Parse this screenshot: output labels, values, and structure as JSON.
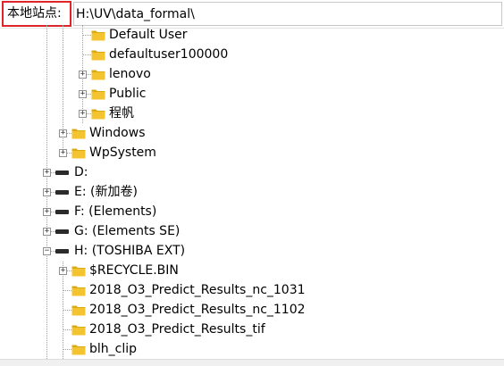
{
  "site_bar": {
    "label": "本地站点:",
    "path": "H:\\UV\\data_formal\\"
  },
  "tree": {
    "items": [
      {
        "label": "Default User",
        "kind": "folder",
        "expander": "none"
      },
      {
        "label": "defaultuser100000",
        "kind": "folder",
        "expander": "none"
      },
      {
        "label": "lenovo",
        "kind": "folder",
        "expander": "collapsed"
      },
      {
        "label": "Public",
        "kind": "folder",
        "expander": "collapsed"
      },
      {
        "label": "程帆",
        "kind": "folder",
        "expander": "collapsed"
      },
      {
        "label": "Windows",
        "kind": "folder",
        "expander": "collapsed"
      },
      {
        "label": "WpSystem",
        "kind": "folder",
        "expander": "collapsed"
      },
      {
        "label": "D:",
        "kind": "drive",
        "expander": "collapsed"
      },
      {
        "label": "E: (新加卷)",
        "kind": "drive",
        "expander": "collapsed"
      },
      {
        "label": "F: (Elements)",
        "kind": "drive",
        "expander": "collapsed"
      },
      {
        "label": "G: (Elements SE)",
        "kind": "drive",
        "expander": "collapsed"
      },
      {
        "label": "H: (TOSHIBA EXT)",
        "kind": "drive",
        "expander": "expanded"
      },
      {
        "label": "$RECYCLE.BIN",
        "kind": "folder",
        "expander": "collapsed"
      },
      {
        "label": "2018_O3_Predict_Results_nc_1031",
        "kind": "folder",
        "expander": "none"
      },
      {
        "label": "2018_O3_Predict_Results_nc_1102",
        "kind": "folder",
        "expander": "none"
      },
      {
        "label": "2018_O3_Predict_Results_tif",
        "kind": "folder",
        "expander": "none"
      },
      {
        "label": "blh_clip",
        "kind": "folder",
        "expander": "none"
      }
    ]
  },
  "colors": {
    "folder": "#f4c430",
    "folder_dark": "#dca90f",
    "highlight_border": "#e0252a",
    "drive": "#2b2b2b"
  }
}
